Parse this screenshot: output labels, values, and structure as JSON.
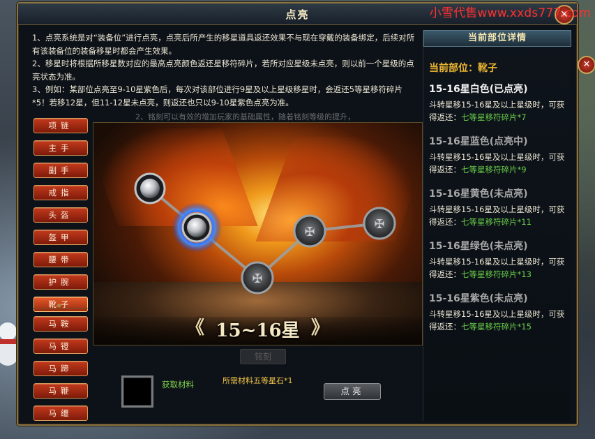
{
  "watermark": "小雪代售www.xxds777.com",
  "window": {
    "title": "点亮",
    "close_icon": "✕"
  },
  "info": {
    "lines": [
      "1、点亮系统是对“装备位”进行点亮，点亮后所产生的移星道具返还效果不与现在穿戴的装备绑定，后续对所有该装备位的装备移星时都会产生效果。",
      "2、移星时将根据所移星数对应的最高点亮颜色返还星移符碎片，若所对应星级未点亮，则以前一个星级的点亮状态为准。",
      "3、例如：某部位点亮至9-10星紫色后，每次对该部位进行9星及以上星级移星时，会返还5等星移符碎片*5！若移12星，但11-12星未点亮，则返还也只以9-10星紫色点亮为准。"
    ],
    "ghost_text": "2、铭刻可以有效的增加玩家的基础属性，随着铭刻等级的提升，"
  },
  "menu": {
    "items": [
      {
        "label": "项链",
        "active": false
      },
      {
        "label": "主手",
        "active": false
      },
      {
        "label": "副手",
        "active": false
      },
      {
        "label": "戒指",
        "active": false
      },
      {
        "label": "头盔",
        "active": false
      },
      {
        "label": "盔甲",
        "active": false
      },
      {
        "label": "腰带",
        "active": false
      },
      {
        "label": "护腕",
        "active": false
      },
      {
        "label": "靴子",
        "active": true
      }
    ],
    "mount_items": [
      {
        "label": "马鞍"
      },
      {
        "label": "马镫"
      },
      {
        "label": "马蹄"
      },
      {
        "label": "马鞭"
      },
      {
        "label": "马缰"
      }
    ]
  },
  "star_display": {
    "label": "15~16星",
    "left_arrow": "《",
    "right_arrow": "》"
  },
  "bottom": {
    "ghost_button": "铭刻",
    "get_material": "获取材料",
    "required": "所需材料五等星石*1",
    "light_button": "点亮"
  },
  "right_panel": {
    "header": "当前部位详情",
    "current": "当前部位：靴子",
    "sections": [
      {
        "title": "15-16星白色(已点亮)",
        "desc": "斗转星移15-16星及以上星级时，可获得返还：",
        "reward": "七等星移符碎片*7",
        "dim": false
      },
      {
        "title": "15-16星蓝色(点亮中)",
        "desc": "斗转星移15-16星及以上星级时，可获得返还：",
        "reward": "七等星移符碎片*9",
        "dim": true
      },
      {
        "title": "15-16星黄色(未点亮)",
        "desc": "斗转星移15-16星及以上星级时，可获得返还：",
        "reward": "七等星移符碎片*11",
        "dim": true
      },
      {
        "title": "15-16星绿色(未点亮)",
        "desc": "斗转星移15-16星及以上星级时，可获得返还：",
        "reward": "七等星移符碎片*13",
        "dim": true
      },
      {
        "title": "15-16星紫色(未点亮)",
        "desc": "斗转星移15-16星及以上星级时，可获得返还：",
        "reward": "七等星移符碎片*15",
        "dim": true
      }
    ]
  },
  "colors": {
    "accent_gold": "#f0b830",
    "reward_green": "#6ad04a",
    "menu_red": "#c23a1c"
  }
}
